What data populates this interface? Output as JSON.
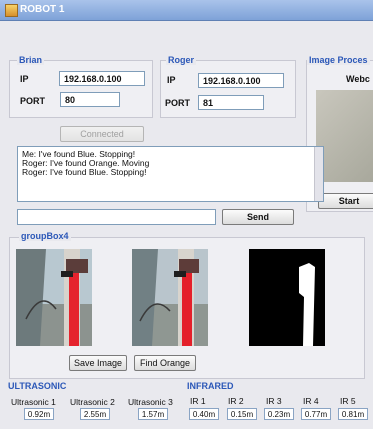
{
  "window": {
    "title": "ROBOT 1"
  },
  "brian": {
    "legend": "Brian",
    "ip_label": "IP",
    "ip_value": "192.168.0.100",
    "port_label": "PORT",
    "port_value": "80"
  },
  "roger": {
    "legend": "Roger",
    "ip_label": "IP",
    "ip_value": "192.168.0.100",
    "port_label": "PORT",
    "port_value": "81"
  },
  "image_process": {
    "legend": "Image Proces",
    "webcam_label": "Webc",
    "start_label": "Start"
  },
  "connection": {
    "button_label": "Connected"
  },
  "chat": {
    "lines": [
      "Me: I've found Blue. Stopping!",
      "Roger: I've found Orange. Moving",
      "Roger: I've found Blue. Stopping!"
    ],
    "input_value": "",
    "send_label": "Send"
  },
  "groupbox4": {
    "legend": "groupBox4",
    "save_image_label": "Save Image",
    "find_orange_label": "Find Orange"
  },
  "ultrasonic": {
    "legend": "ULTRASONIC",
    "sensors": [
      {
        "label": "Ultrasonic 1",
        "value": "0.92m"
      },
      {
        "label": "Ultrasonic 2",
        "value": "2.55m"
      },
      {
        "label": "Ultrasonic 3",
        "value": "1.57m"
      }
    ]
  },
  "infrared": {
    "legend": "INFRARED",
    "sensors": [
      {
        "label": "IR 1",
        "value": "0.40m"
      },
      {
        "label": "IR 2",
        "value": "0.15m"
      },
      {
        "label": "IR 3",
        "value": "0.23m"
      },
      {
        "label": "IR 4",
        "value": "0.77m"
      },
      {
        "label": "IR 5",
        "value": "0.81m"
      }
    ]
  },
  "colors": {
    "legend_blue": "#2c58b8",
    "title_bar": "#7ea2d8",
    "panel_bg": "#efeff3"
  }
}
